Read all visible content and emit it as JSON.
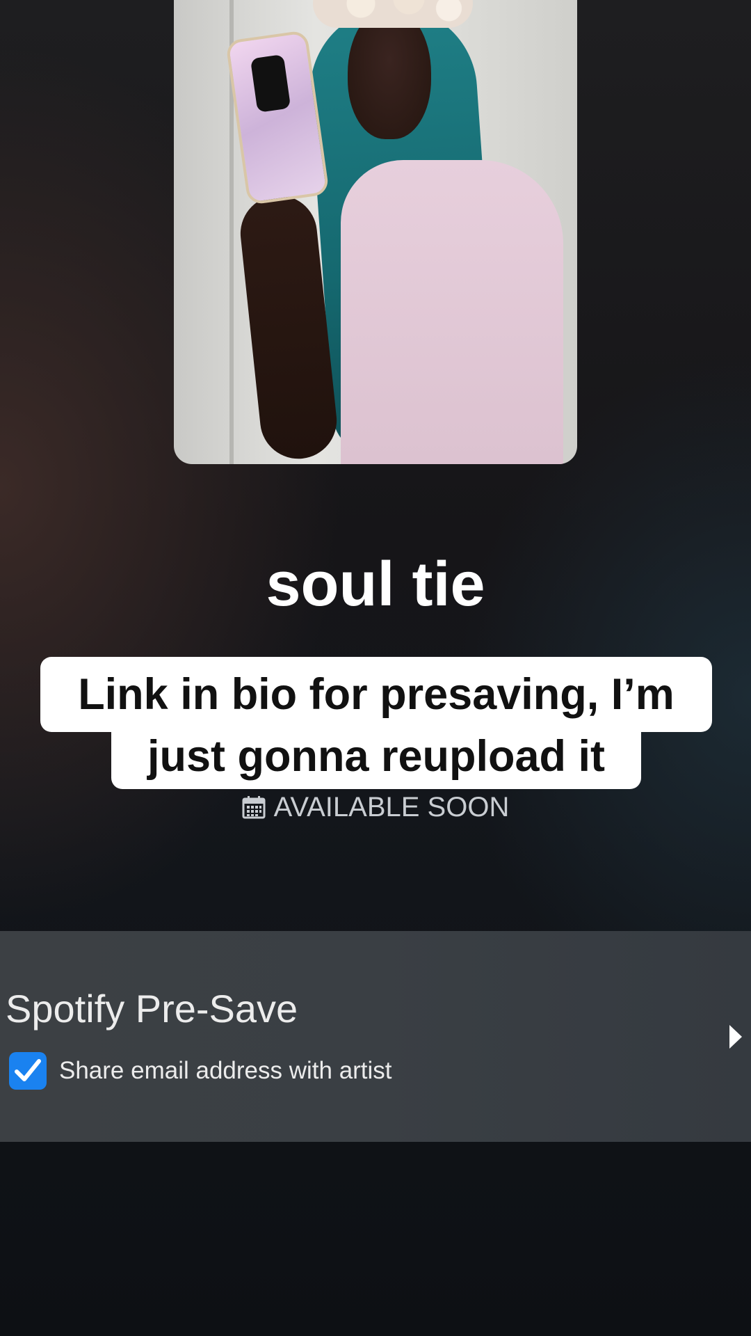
{
  "release": {
    "title": "soul tie",
    "status": "AVAILABLE SOON"
  },
  "caption": {
    "line1": "Link in bio for presaving, I’m",
    "line2": "just gonna reupload it"
  },
  "presave": {
    "title": "Spotify Pre-Save",
    "share_label": "Share email address with artist",
    "share_checked": true
  },
  "colors": {
    "checkbox": "#1a82f0",
    "panel": "#3b3f44"
  },
  "icons": {
    "calendar": "calendar-icon",
    "check": "checkmark-icon",
    "arrow": "chevron-right-icon"
  }
}
